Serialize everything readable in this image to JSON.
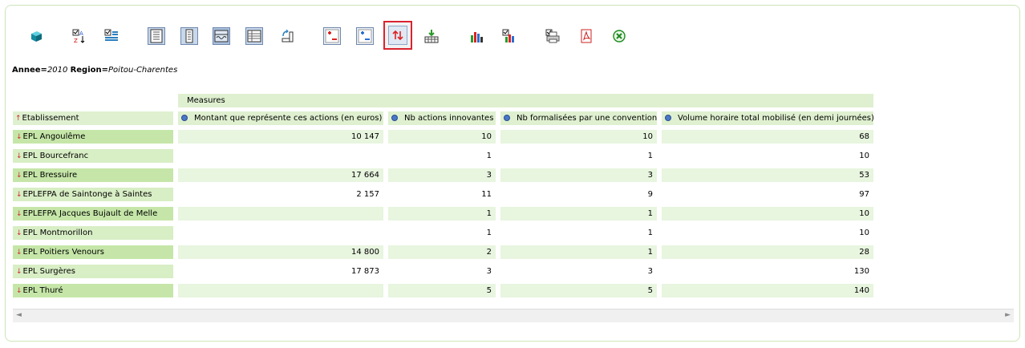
{
  "toolbar": {
    "buttons": [
      {
        "icon": "cube-icon"
      },
      {
        "icon": "sort-az-icon"
      },
      {
        "icon": "table-list-icon"
      },
      {
        "icon": "page-outline-icon"
      },
      {
        "icon": "page-columns-icon"
      },
      {
        "icon": "table-wave-icon"
      },
      {
        "icon": "table-grid-icon"
      },
      {
        "icon": "swap-axes-icon"
      },
      {
        "icon": "collapse-red-icon"
      },
      {
        "icon": "expand-blue-icon"
      },
      {
        "icon": "sort-updown-icon"
      },
      {
        "icon": "download-grid-icon"
      },
      {
        "icon": "bar-chart-icon"
      },
      {
        "icon": "chart-config-icon"
      },
      {
        "icon": "print-icon"
      },
      {
        "icon": "pdf-icon"
      },
      {
        "icon": "excel-icon"
      }
    ]
  },
  "filter": {
    "annee_label": "Annee",
    "annee_value": "2010",
    "region_label": "Region",
    "region_value": "Poitou-Charentes"
  },
  "table": {
    "measures_label": "Measures",
    "row_header": "Etablissement",
    "columns": [
      "Montant que représente ces actions (en euros)",
      "Nb actions innovantes",
      "Nb formalisées par une convention",
      "Volume horaire total mobilisé (en demi journées)"
    ],
    "rows": [
      {
        "label": "EPL Angoulême",
        "values": [
          "10 147",
          "10",
          "10",
          "68"
        ]
      },
      {
        "label": "EPL Bourcefranc",
        "values": [
          "",
          "1",
          "1",
          "10"
        ]
      },
      {
        "label": "EPL Bressuire",
        "values": [
          "17 664",
          "3",
          "3",
          "53"
        ]
      },
      {
        "label": "EPLEFPA de Saintonge à Saintes",
        "values": [
          "2 157",
          "11",
          "9",
          "97"
        ]
      },
      {
        "label": "EPLEFPA Jacques Bujault de Melle",
        "values": [
          "",
          "1",
          "1",
          "10"
        ]
      },
      {
        "label": "EPL Montmorillon",
        "values": [
          "",
          "1",
          "1",
          "10"
        ]
      },
      {
        "label": "EPL Poitiers Venours",
        "values": [
          "14 800",
          "2",
          "1",
          "28"
        ]
      },
      {
        "label": "EPL Surgères",
        "values": [
          "17 873",
          "3",
          "3",
          "130"
        ]
      },
      {
        "label": "EPL Thuré",
        "values": [
          "",
          "5",
          "5",
          "140"
        ]
      }
    ]
  },
  "scroll": {
    "left": "◄",
    "right": "►"
  }
}
